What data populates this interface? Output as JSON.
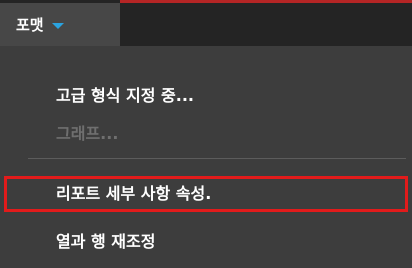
{
  "menubar": {
    "format_menu_label": "포맷",
    "chevron_icon": "chevron-down-icon",
    "accent_color": "#2aa3e0",
    "highlight_color": "#e21b1b"
  },
  "dropdown": {
    "items": [
      {
        "label": "고급 형식 지정 중...",
        "enabled": true
      },
      {
        "label": "그래프...",
        "enabled": false
      },
      {
        "label": "리포트 세부 사항 속성.",
        "enabled": true
      },
      {
        "label": "열과 행 재조정",
        "enabled": true
      }
    ]
  }
}
